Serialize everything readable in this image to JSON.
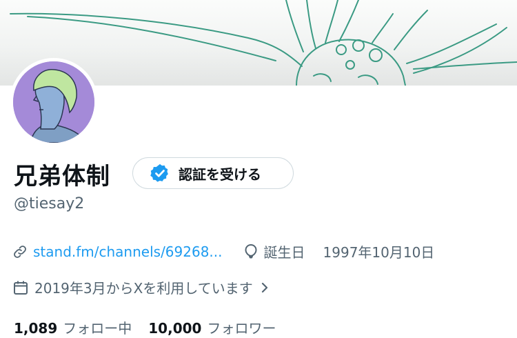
{
  "banner": {
    "description_icon": "sketch-banner-image"
  },
  "profile": {
    "display_name": "兄弟体制",
    "handle": "@tiesay2",
    "verify_button_label": "認証を受ける",
    "link_text": "stand.fm/channels/69268...",
    "birthday_label": "誕生日",
    "birthday_value": "1997年10月10日",
    "joined_text": "2019年3月からXを利用しています"
  },
  "stats": {
    "following_count": "1,089",
    "following_label": "フォロー中",
    "followers_count": "10,000",
    "followers_label": "フォロワー"
  },
  "colors": {
    "link": "#1d9bf0",
    "muted": "#536471",
    "verified": "#1d9bf0",
    "avatar_bg": "#a48ad8"
  }
}
